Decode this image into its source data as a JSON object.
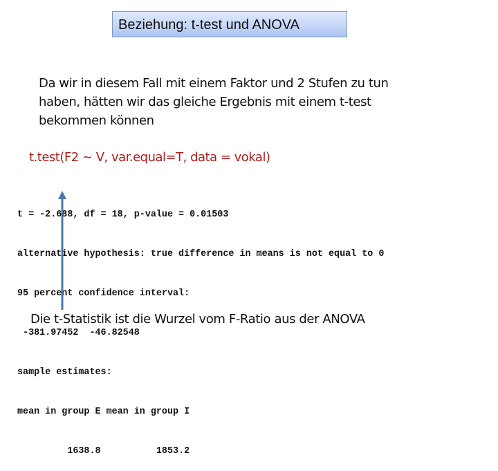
{
  "slide": {
    "title": "Beziehung: t-test und ANOVA",
    "intro_lines": [
      "Da wir in diesem Fall mit einem Faktor und 2 Stufen zu tun",
      "haben, hätten wir das gleiche Ergebnis mit einem t-test",
      "bekommen können"
    ],
    "r_command": "t.test(F2 ~ V, var.equal=T, data = vokal)",
    "r_output_lines": [
      "t = -2.688, df = 18, p-value = 0.01503",
      "alternative hypothesis: true difference in means is not equal to 0",
      "95 percent confidence interval:",
      " -381.97452  -46.82548",
      "sample estimates:",
      "mean in group E mean in group I",
      "         1638.8          1853.2"
    ],
    "footer_note": "Die t-Statistik ist die Wurzel vom F-Ratio aus der ANOVA",
    "arrow_icon": "up-arrow-icon",
    "colors": {
      "title_gradient_top": "#dfe9fb",
      "title_gradient_bottom": "#a9c2f0",
      "title_border": "#7f9db9",
      "r_command": "#b01c1c",
      "arrow": "#4a76a8"
    }
  }
}
